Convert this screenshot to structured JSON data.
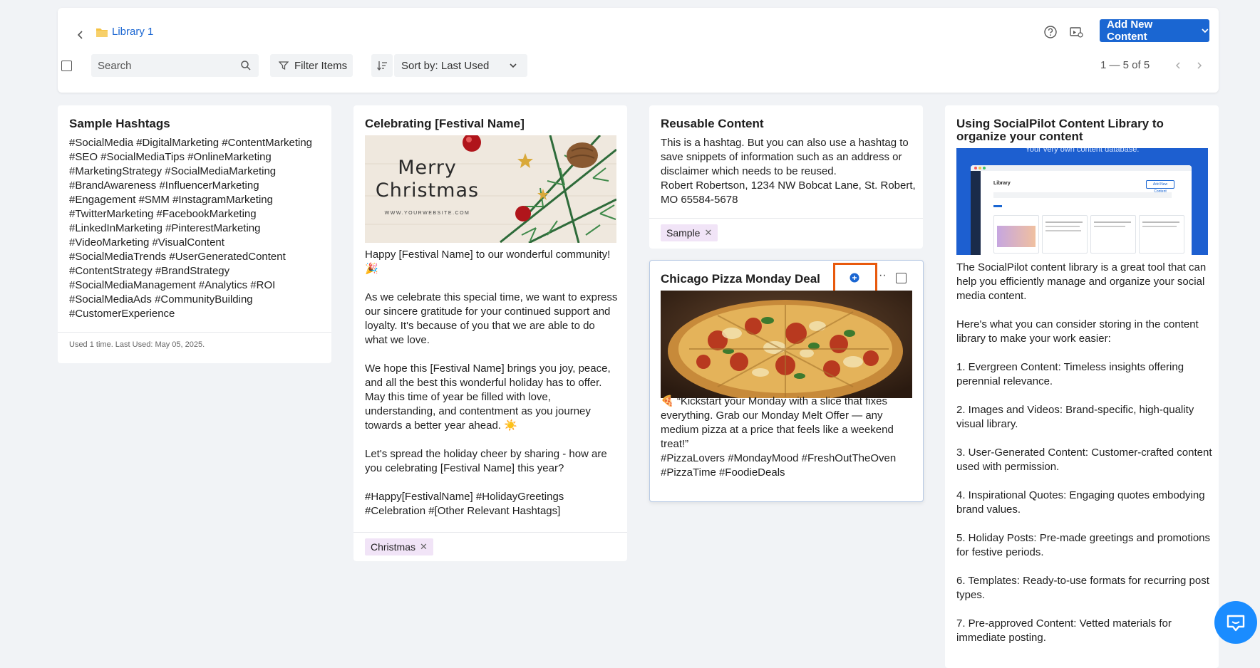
{
  "header": {
    "library_name": "Library 1",
    "add_button_label": "Add New Content",
    "search_placeholder": "Search",
    "filter_label": "Filter Items",
    "sort_label": "Sort by: Last Used",
    "pagination": "1 — 5 of 5"
  },
  "cards": {
    "hashtags": {
      "title": "Sample Hashtags",
      "body": "#SocialMedia #DigitalMarketing #ContentMarketing\n#SEO #SocialMediaTips #OnlineMarketing\n#MarketingStrategy #SocialMediaMarketing\n#BrandAwareness #InfluencerMarketing\n#Engagement #SMM #InstagramMarketing\n#TwitterMarketing #FacebookMarketing\n#LinkedInMarketing #PinterestMarketing\n#VideoMarketing #VisualContent\n#SocialMediaTrends #UserGeneratedContent\n#ContentStrategy #BrandStrategy\n#SocialMediaManagement #Analytics #ROI\n#SocialMediaAds #CommunityBuilding\n#CustomerExperience",
      "footer": "Used 1 time. Last Used: May 05, 2025."
    },
    "festival": {
      "title": "Celebrating [Festival Name]",
      "image_line1": "Merry",
      "image_line2": "Christmas",
      "image_url": "WWW.YOURWEBSITE.COM",
      "body": "Happy [Festival Name] to our wonderful community! 🎉\n\nAs we celebrate this special time, we want to express our sincere gratitude for your continued support and loyalty. It's because of you that we are able to do what we love.\n\nWe hope this [Festival Name] brings you joy, peace, and all the best this wonderful holiday has to offer. May this time of year be filled with love, understanding, and contentment as you journey towards a better year ahead. ☀️\n\nLet's spread the holiday cheer by sharing - how are you celebrating [Festival Name] this year?\n\n#Happy[FestivalName] #HolidayGreetings\n#Celebration #[Other Relevant Hashtags]",
      "tag": "Christmas"
    },
    "reusable": {
      "title": "Reusable Content",
      "body": "This is a hashtag. But you can also use a hashtag to save snippets of information such as an address or disclaimer which needs to be reused.\nRobert Robertson, 1234 NW Bobcat Lane, St. Robert, MO 65584-5678",
      "tag": "Sample"
    },
    "pizza": {
      "title": "Chicago Pizza Monday Deal",
      "body": "🍕 “Kickstart your Monday with a slice that fixes everything. Grab our Monday Melt Offer — any medium pizza at a price that feels like a weekend treat!”\n#PizzaLovers #MondayMood #FreshOutTheOven\n#PizzaTime #FoodieDeals"
    },
    "socialpilot": {
      "title": "Using SocialPilot Content Library to organize your content",
      "image_caption": "Your very own content database.",
      "image_app_title": "Library",
      "image_add_btn": "Add New Content",
      "body": "The SocialPilot content library is a great tool that can help you efficiently manage and organize your social media content.\n\nHere's what you can consider storing in the content library to make your work easier:\n\n1. Evergreen Content: Timeless insights offering perennial relevance.\n\n2. Images and Videos: Brand-specific, high-quality visual library.\n\n3. User-Generated Content: Customer-crafted content used with permission.\n\n4. Inspirational Quotes: Engaging quotes embodying brand values.\n\n5. Holiday Posts: Pre-made greetings and promotions for festive periods.\n\n6. Templates: Ready-to-use formats for recurring post types.\n\n7. Pre-approved Content: Vetted materials for immediate posting."
    }
  },
  "colors": {
    "accent": "#1a66d2",
    "highlight": "#e8590c",
    "tag_bg": "#f1e4f7"
  },
  "icons": [
    "chevron-left-icon",
    "folder-icon",
    "help-icon",
    "screen-record-icon",
    "chevron-down-icon",
    "search-icon",
    "filter-icon",
    "sort-icon",
    "chevron-right-icon",
    "close-icon",
    "plus-circle-icon",
    "more-icon",
    "chat-icon"
  ]
}
